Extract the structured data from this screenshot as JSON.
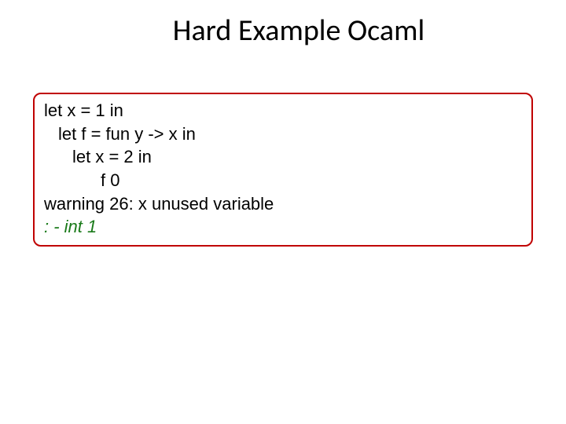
{
  "title": "Hard Example Ocaml",
  "code": {
    "line1": "let x = 1 in",
    "line2": "let f = fun y -> x in",
    "line3": "let x = 2 in",
    "line4": "f 0",
    "line5": "warning 26: x unused variable",
    "line6": ": - int 1"
  }
}
